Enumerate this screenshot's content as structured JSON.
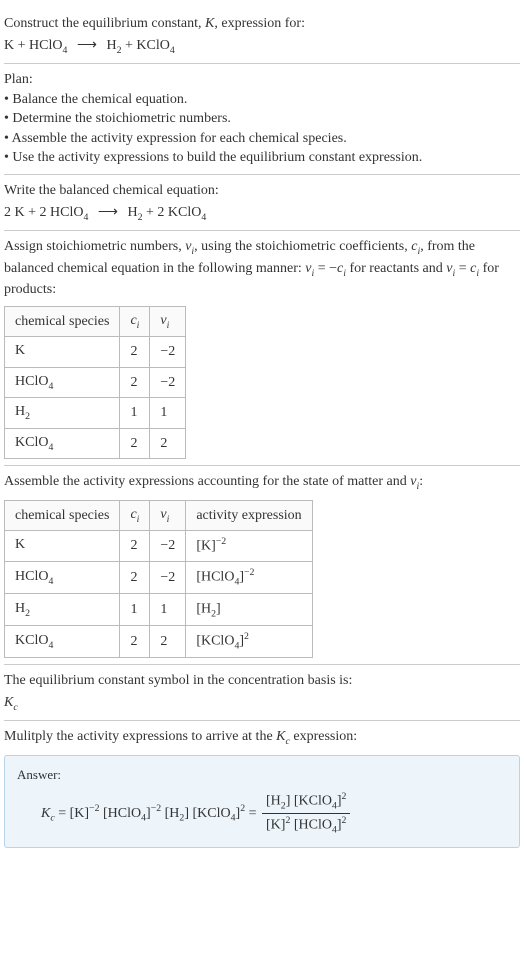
{
  "intro": {
    "line1": "Construct the equilibrium constant, ",
    "Kvar": "K",
    "line1b": ", expression for:",
    "eq_lhs_1": "K + HClO",
    "eq_lhs_sub": "4",
    "eq_arrow": "⟶",
    "eq_rhs_1": "H",
    "eq_rhs_sub1": "2",
    "eq_rhs_2": " + KClO",
    "eq_rhs_sub2": "4"
  },
  "plan": {
    "heading": "Plan:",
    "items": [
      "Balance the chemical equation.",
      "Determine the stoichiometric numbers.",
      "Assemble the activity expression for each chemical species.",
      "Use the activity expressions to build the equilibrium constant expression."
    ]
  },
  "balanced": {
    "heading": "Write the balanced chemical equation:",
    "lhs_1": "2 K + 2 HClO",
    "lhs_sub": "4",
    "arrow": "⟶",
    "rhs_1": "H",
    "rhs_sub1": "2",
    "rhs_2": " + 2 KClO",
    "rhs_sub2": "4"
  },
  "stoich": {
    "heading_1": "Assign stoichiometric numbers, ",
    "nu": "ν",
    "isub": "i",
    "heading_2": ", using the stoichiometric coefficients, ",
    "cvar": "c",
    "heading_3": ", from the balanced chemical equation in the following manner: ",
    "rel1a": "ν",
    "rel1b": " = −",
    "rel1c": "c",
    "heading_4": " for reactants and ",
    "rel2a": "ν",
    "rel2b": " = ",
    "rel2c": "c",
    "heading_5": " for products:",
    "table": {
      "headers": [
        "chemical species",
        "c_i",
        "ν_i"
      ],
      "rows": [
        {
          "species": "K",
          "sub": "",
          "c": "2",
          "nu": "−2"
        },
        {
          "species": "HClO",
          "sub": "4",
          "c": "2",
          "nu": "−2"
        },
        {
          "species": "H",
          "sub": "2",
          "c": "1",
          "nu": "1"
        },
        {
          "species": "KClO",
          "sub": "4",
          "c": "2",
          "nu": "2"
        }
      ]
    }
  },
  "activity": {
    "heading_1": "Assemble the activity expressions accounting for the state of matter and ",
    "nu": "ν",
    "isub": "i",
    "heading_2": ":",
    "table": {
      "headers": [
        "chemical species",
        "c_i",
        "ν_i",
        "activity expression"
      ],
      "rows": [
        {
          "species": "K",
          "sub": "",
          "c": "2",
          "nu": "−2",
          "act_base": "[K]",
          "act_sub": "",
          "act_exp": "−2"
        },
        {
          "species": "HClO",
          "sub": "4",
          "c": "2",
          "nu": "−2",
          "act_base": "[HClO",
          "act_sub": "4",
          "act_close": "]",
          "act_exp": "−2"
        },
        {
          "species": "H",
          "sub": "2",
          "c": "1",
          "nu": "1",
          "act_base": "[H",
          "act_sub": "2",
          "act_close": "]",
          "act_exp": ""
        },
        {
          "species": "KClO",
          "sub": "4",
          "c": "2",
          "nu": "2",
          "act_base": "[KClO",
          "act_sub": "4",
          "act_close": "]",
          "act_exp": "2"
        }
      ]
    }
  },
  "kc_symbol": {
    "line1": "The equilibrium constant symbol in the concentration basis is:",
    "K": "K",
    "csub": "c"
  },
  "multiply": {
    "line1": "Mulitply the activity expressions to arrive at the ",
    "K": "K",
    "csub": "c",
    "line2": " expression:"
  },
  "answer": {
    "label": "Answer:",
    "Kc_K": "K",
    "Kc_c": "c",
    "eq": " = ",
    "t1": "[K]",
    "t1exp": "−2",
    "t2a": " [HClO",
    "t2sub": "4",
    "t2b": "]",
    "t2exp": "−2",
    "t3a": " [H",
    "t3sub": "2",
    "t3b": "]",
    "t4a": " [KClO",
    "t4sub": "4",
    "t4b": "]",
    "t4exp": "2",
    "eq2": " = ",
    "num_a": "[H",
    "num_asub": "2",
    "num_b": "] [KClO",
    "num_bsub": "4",
    "num_c": "]",
    "num_exp": "2",
    "den_a": "[K]",
    "den_aexp": "2",
    "den_b": " [HClO",
    "den_bsub": "4",
    "den_c": "]",
    "den_cexp": "2"
  }
}
